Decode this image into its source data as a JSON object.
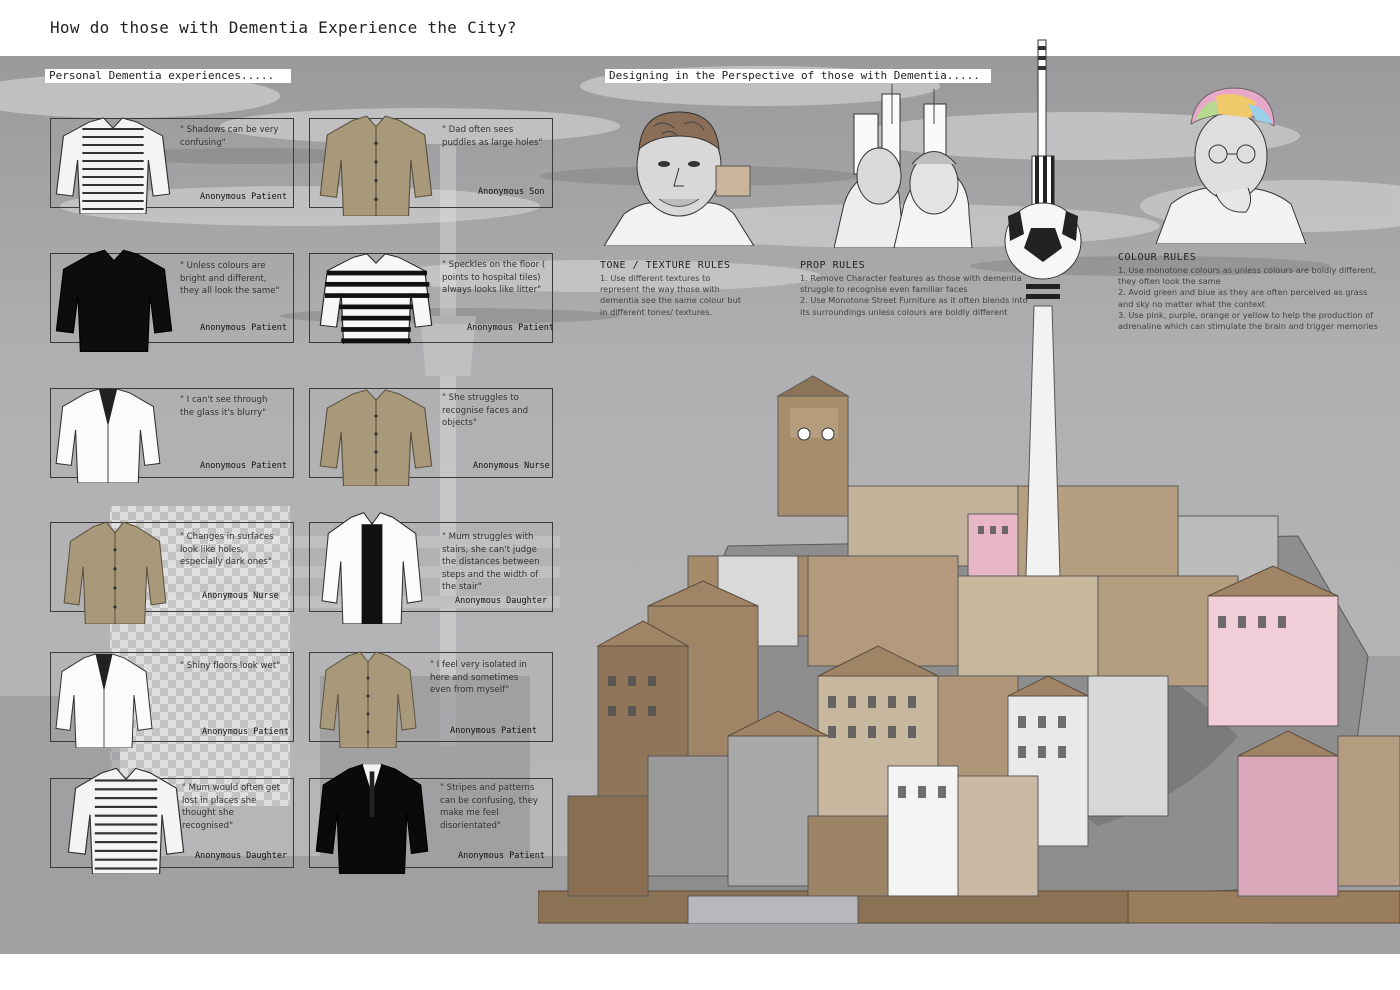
{
  "title": "How do those with Dementia Experience the City?",
  "left_section_label": "Personal Dementia experiences.....",
  "right_section_label": "Designing in the Perspective of those with Dementia.....",
  "cards": [
    {
      "quote": "\" Shadows can be very confusing\"",
      "attribution": "Anonymous Patient",
      "garment": "newspaper-shirt"
    },
    {
      "quote": "\" Dad often sees puddles as large holes\"",
      "attribution": "Anonymous Son",
      "garment": "khaki-shirt"
    },
    {
      "quote": "\" Unless colours are bright and different, they all look the same\"",
      "attribution": "Anonymous Patient",
      "garment": "black-sweater"
    },
    {
      "quote": "\" Speckles on the floor ( points to hospital tiles) always looks like litter\"",
      "attribution": "Anonymous Patient",
      "garment": "striped-top"
    },
    {
      "quote": "\" I can't see through the glass it's blurry\"",
      "attribution": "Anonymous Patient",
      "garment": "white-shirt"
    },
    {
      "quote": "\" She struggles to recognise faces and objects\"",
      "attribution": "Anonymous Nurse",
      "garment": "khaki-pocket-shirt"
    },
    {
      "quote": "\" Changes in surfaces look like holes, especially dark ones\"",
      "attribution": "Anonymous Nurse",
      "garment": "khaki-jacket"
    },
    {
      "quote": "\" Mum struggles with stairs, she can't judge the distances between steps and the width of the stair\"",
      "attribution": "Anonymous Daughter",
      "garment": "white-cardigan"
    },
    {
      "quote": "\" Shiny floors look wet\"",
      "attribution": "Anonymous Patient",
      "garment": "white-blazer"
    },
    {
      "quote": "\" I feel very isolated in here and sometimes even from myself\"",
      "attribution": "Anonymous Patient",
      "garment": "khaki-cardigan"
    },
    {
      "quote": "\" Mum would often get lost in places she thought she recognised\"",
      "attribution": "Anonymous Daughter",
      "garment": "newspaper-shirt-2"
    },
    {
      "quote": "\" Stripes and patterns can be confusing, they make me feel disorientated\"",
      "attribution": "Anonymous Patient",
      "garment": "black-suit"
    }
  ],
  "rules": [
    {
      "title": "TONE / TEXTURE RULES",
      "text": "1. Use different textures to represent the way those with dementia see the same colour but in different tones/ textures."
    },
    {
      "title": "PROP RULES",
      "text": "1. Remove Character features as those with dementia struggle to recognise even familiar faces\n2. Use Monotone Street Furniture as it often blends into its surroundings unless colours are boldly different"
    },
    {
      "title": "COLOUR RULES",
      "text": "1. Use monotone colours as unless colours are boldly different, they often look the same\n2. Avoid green and blue as they are often perceived as grass and sky no matter what the context\n3. Use pink, purple, orange or yellow to help the production of adrenaline which can stimulate the brain and trigger memories"
    }
  ],
  "newspaper_snippets": [
    "symptoms of hearing",
    "loss are strikingly similar",
    "those of dementia and",
    "National",
    "on the current",
    "of the",
    "commonly",
    "social isolation",
    "hearing evaluation",
    "for the cost",
    "able cost of $45"
  ],
  "clock_numerals": [
    "12",
    "3",
    "6",
    "9"
  ],
  "colors": {
    "page": "#ffffff",
    "background": "#a9a9ab",
    "card_border": "#3a3a3a",
    "cardboard": "#a08a6c",
    "pink": "#e8bccb",
    "khaki": "#a8997a"
  }
}
